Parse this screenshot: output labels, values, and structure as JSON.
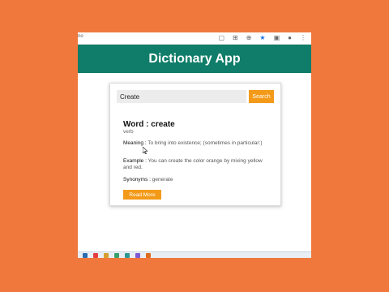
{
  "app": {
    "title": "Dictionary App"
  },
  "browser": {
    "url_fragment": "no"
  },
  "search": {
    "value": "Create",
    "button_label": "Search"
  },
  "result": {
    "word_label": "Word : create",
    "part_of_speech": "verb",
    "meaning_label": "Meaning :",
    "meaning_text": "To bring into existence; (sometimes in particular:)",
    "example_label": "Example :",
    "example_text": "You can create the color orange by mixing yellow and red.",
    "synonyms_label": "Synonyms :",
    "synonyms_text": "generate",
    "read_more_label": "Read More"
  },
  "colors": {
    "header": "#0f7d69",
    "accent": "#f39a19",
    "frame": "#f0783c"
  },
  "taskbar": {
    "clock_fragment": ""
  }
}
